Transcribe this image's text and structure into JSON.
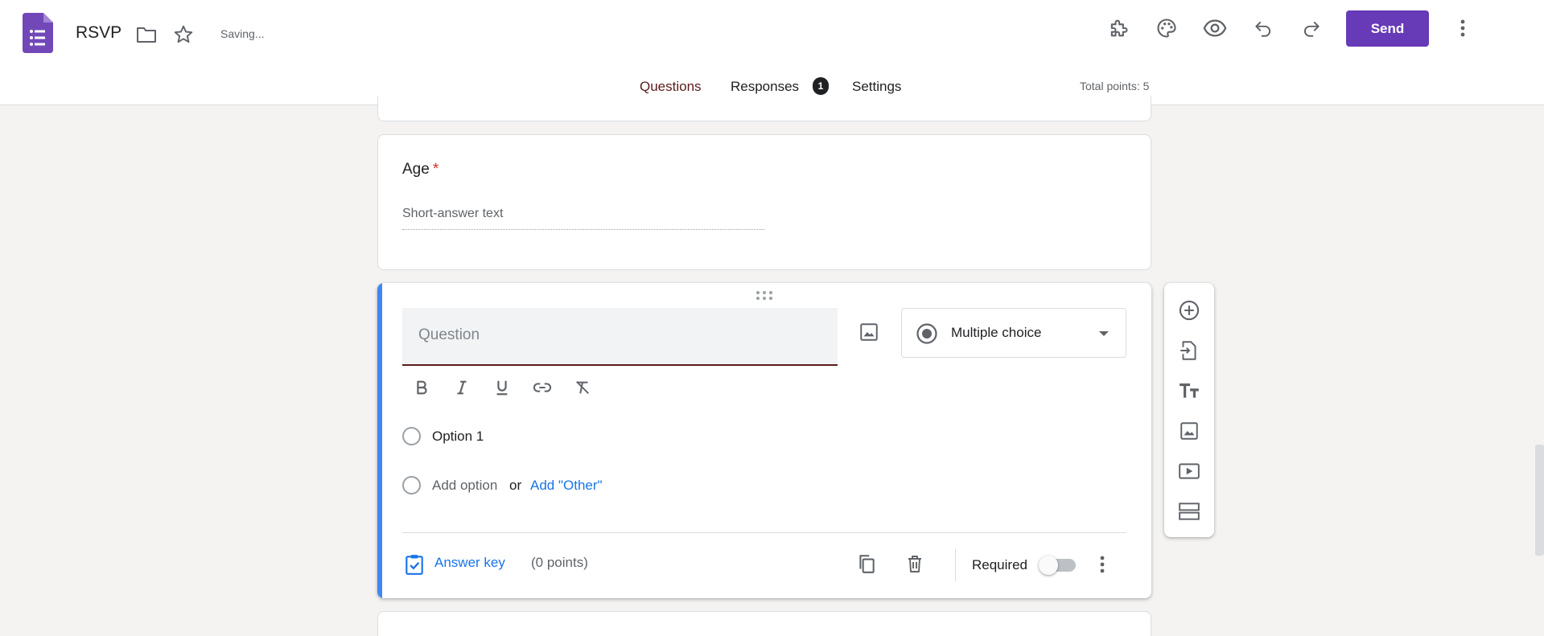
{
  "header": {
    "title": "RSVP",
    "status": "Saving...",
    "send_label": "Send",
    "accent_color": "#673ab7",
    "icons": [
      "forms-logo-icon",
      "folder-icon",
      "star-icon",
      "addons-puzzle-icon",
      "palette-icon",
      "preview-eye-icon",
      "undo-icon",
      "redo-icon",
      "more-vert-icon"
    ]
  },
  "tabs": [
    {
      "label": "Questions",
      "active": true
    },
    {
      "label": "Responses",
      "badge": "1"
    },
    {
      "label": "Settings"
    }
  ],
  "total_points": "Total points: 5",
  "questions": {
    "age": {
      "title": "Age",
      "required_mark": "*",
      "placeholder": "Short-answer text"
    },
    "active": {
      "placeholder": "Question",
      "type": "Multiple choice",
      "options": [
        "Option 1"
      ],
      "add_option": "Add option",
      "or_text": "or",
      "add_other": "Add \"Other\"",
      "answer_key": "Answer key",
      "points": "(0 points)",
      "required_label": "Required",
      "required": false,
      "format_tools": [
        "bold-icon",
        "italic-icon",
        "underline-icon",
        "link-icon",
        "clear-format-icon"
      ]
    }
  },
  "side_toolbar": [
    "add-question-icon",
    "import-questions-icon",
    "add-title-icon",
    "add-image-icon",
    "add-video-icon",
    "add-section-icon"
  ]
}
